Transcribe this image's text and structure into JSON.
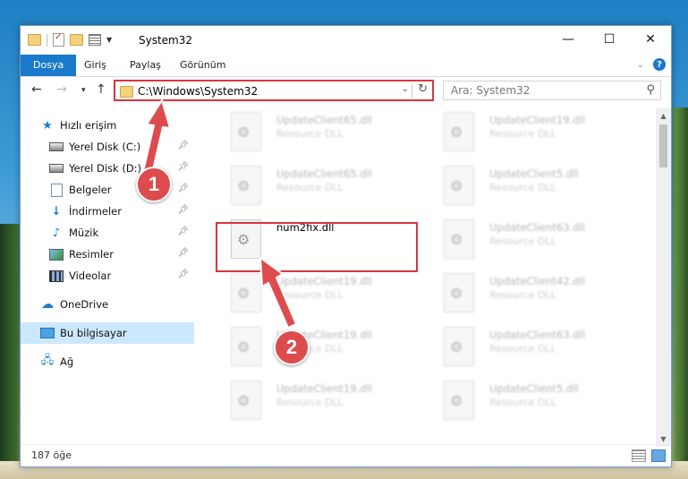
{
  "window": {
    "title": "System32",
    "controls": {
      "minimize": "—",
      "maximize": "☐",
      "close": "✕"
    }
  },
  "ribbon": {
    "tabs": [
      "Dosya",
      "Giriş",
      "Paylaş",
      "Görünüm"
    ],
    "active_tab": "Dosya",
    "help": "?"
  },
  "address_bar": {
    "path": "C:\\Windows\\System32",
    "search_placeholder": "Ara: System32"
  },
  "sidebar": {
    "items": [
      {
        "label": "Hızlı erişim",
        "icon": "star-icon",
        "pinned": false
      },
      {
        "label": "Yerel Disk (C:)",
        "icon": "disk-icon",
        "pinned": true
      },
      {
        "label": "Yerel Disk (D:)",
        "icon": "disk-icon",
        "pinned": true
      },
      {
        "label": "Belgeler",
        "icon": "documents-icon",
        "pinned": true
      },
      {
        "label": "İndirmeler",
        "icon": "downloads-icon",
        "pinned": true
      },
      {
        "label": "Müzik",
        "icon": "music-icon",
        "pinned": true
      },
      {
        "label": "Resimler",
        "icon": "pictures-icon",
        "pinned": true
      },
      {
        "label": "Videolar",
        "icon": "videos-icon",
        "pinned": true
      },
      {
        "label": "OneDrive",
        "icon": "cloud-icon",
        "pinned": false
      },
      {
        "label": "Bu bilgisayar",
        "icon": "computer-icon",
        "pinned": false,
        "selected": true
      },
      {
        "label": "Ağ",
        "icon": "network-icon",
        "pinned": false
      }
    ]
  },
  "files": [
    {
      "name": "UpdateClient65.dll",
      "type": "Resource DLL"
    },
    {
      "name": "UpdateClient19.dll",
      "type": "Resource DLL"
    },
    {
      "name": "UpdateClient65.dll",
      "type": "Resource DLL"
    },
    {
      "name": "UpdateClient5.dll",
      "type": "Resource DLL"
    },
    {
      "name": "num2fix.dll",
      "type": ""
    },
    {
      "name": "UpdateClient63.dll",
      "type": "Resource DLL"
    },
    {
      "name": "UpdateClient19.dll",
      "type": "Resource DLL"
    },
    {
      "name": "UpdateClient42.dll",
      "type": "Resource DLL"
    },
    {
      "name": "UpdateClient19.dll",
      "type": "Resource DLL"
    },
    {
      "name": "UpdateClient63.dll",
      "type": "Resource DLL"
    },
    {
      "name": "UpdateClient19.dll",
      "type": "Resource DLL"
    },
    {
      "name": "UpdateClient5.dll",
      "type": "Resource DLL"
    }
  ],
  "status": {
    "item_count": "187 öğe"
  },
  "callouts": [
    "1",
    "2"
  ],
  "colors": {
    "accent": "#1979ca",
    "highlight": "#d9363e",
    "selection": "#cce8ff"
  }
}
